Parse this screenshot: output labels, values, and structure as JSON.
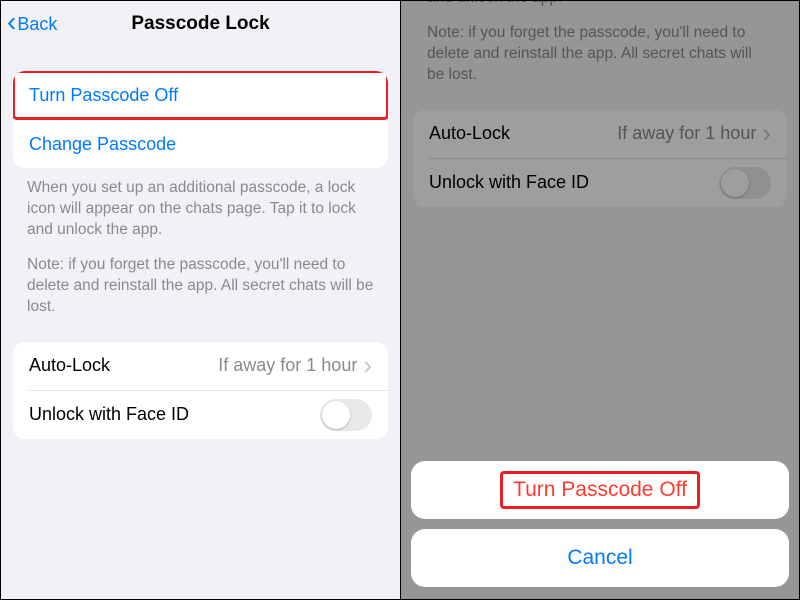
{
  "left": {
    "back_label": "Back",
    "title": "Passcode Lock",
    "actions": {
      "turn_off": "Turn Passcode Off",
      "change": "Change Passcode"
    },
    "note1": "When you set up an additional passcode, a lock icon will appear on the chats page. Tap it to lock and unlock the app.",
    "note2": "Note: if you forget the passcode, you'll need to delete and reinstall the app. All secret chats will be lost.",
    "autolock": {
      "label": "Auto-Lock",
      "value": "If away for 1 hour"
    },
    "faceid": {
      "label": "Unlock with Face ID",
      "on": false
    }
  },
  "right": {
    "note_partial": "icon will appear on the chats page. Tap it to lock and unlock the app.",
    "note2": "Note: if you forget the passcode, you'll need to delete and reinstall the app. All secret chats will be lost.",
    "autolock": {
      "label": "Auto-Lock",
      "value": "If away for 1 hour"
    },
    "faceid": {
      "label": "Unlock with Face ID",
      "on": false
    },
    "sheet": {
      "turn_off": "Turn Passcode Off",
      "cancel": "Cancel"
    }
  }
}
